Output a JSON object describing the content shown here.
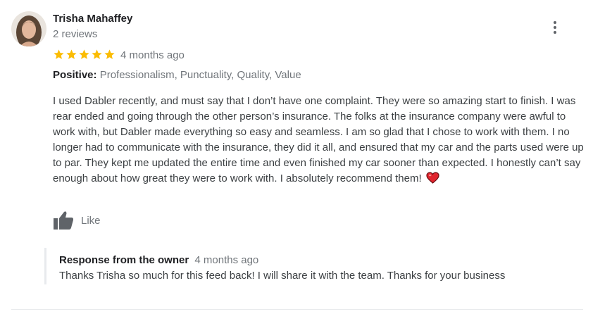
{
  "reviewer": {
    "name": "Trisha Mahaffey",
    "review_count": "2 reviews"
  },
  "rating": {
    "stars": 5,
    "max": 5,
    "star_color": "#fbbc04"
  },
  "date": "4 months ago",
  "positive": {
    "label": "Positive:",
    "values": "Professionalism, Punctuality, Quality, Value"
  },
  "review_text": "I used Dabler recently, and must say that I don’t have one complaint. They were so amazing start to finish. I was rear ended and going through the other person’s insurance. The folks at the insurance company were awful to work with, but Dabler made everything so easy and seamless. I am so glad that I chose to work with them. I no longer had to communicate with the insurance, they did it all, and ensured that my car and the parts used were up to par. They kept me updated the entire time and even finished my car sooner than expected. I honestly can’t say enough about how great they were to work with. I absolutely recommend them!",
  "like": {
    "label": "Like",
    "icon": "thumbs-up-icon"
  },
  "menu_icon": "more-vert-icon",
  "response": {
    "title": "Response from the owner",
    "date": "4 months ago",
    "text": "Thanks Trisha so much for this feed back! I will share it with the team. Thanks for your business"
  }
}
